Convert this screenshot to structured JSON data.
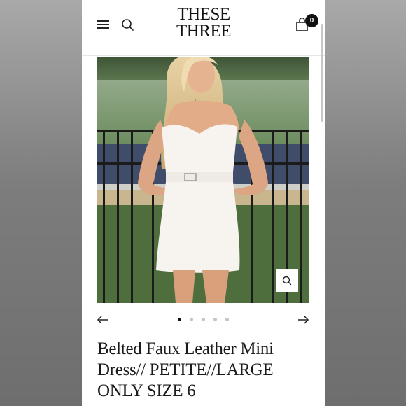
{
  "header": {
    "logo_line1": "THESE",
    "logo_line2": "THREE",
    "cart_count": "0",
    "menu_icon": "hamburger-icon",
    "search_icon": "search-icon",
    "cart_icon": "shopping-bag-icon"
  },
  "gallery": {
    "image_description": "product-photo",
    "zoom_icon": "magnifier-icon",
    "prev_icon": "arrow-left-icon",
    "next_icon": "arrow-right-icon",
    "total_slides": 5,
    "active_slide": 1
  },
  "product": {
    "title": "Belted Faux Leather Mini Dress// PETITE//LARGE ONLY SIZE 6"
  },
  "colors": {
    "text": "#111111",
    "dot_inactive": "#c4c4c4",
    "background": "#ffffff"
  }
}
